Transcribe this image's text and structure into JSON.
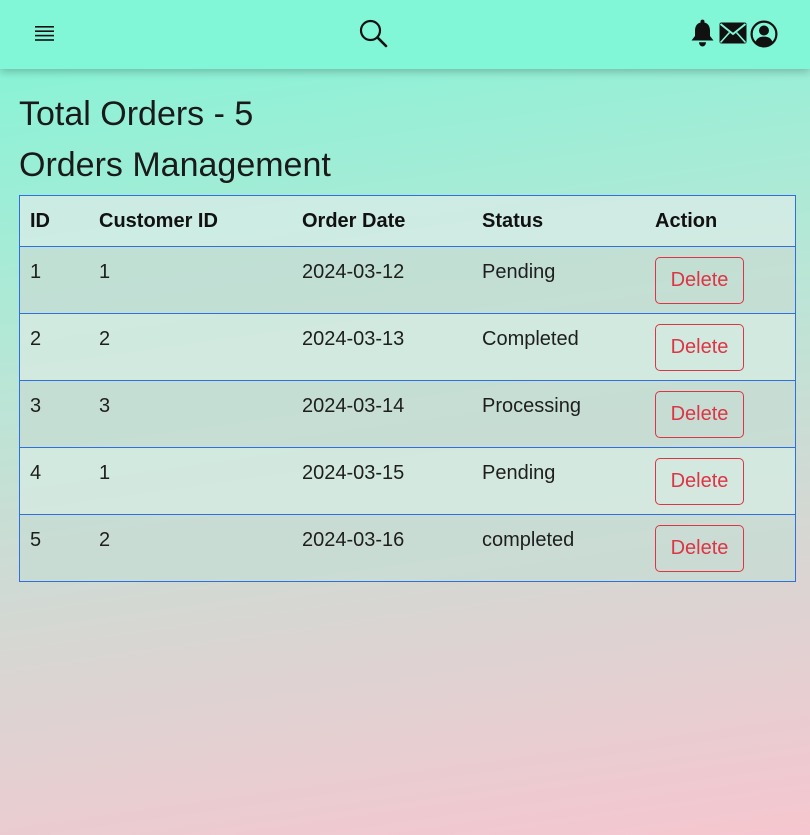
{
  "header": {
    "menu_icon": "hamburger-menu-icon",
    "search_icon": "search-icon",
    "notification_icon": "bell-icon",
    "mail_icon": "mail-icon",
    "account_icon": "user-circle-icon"
  },
  "summary": {
    "total_orders": "Total Orders - 5"
  },
  "page_title": "Orders Management",
  "table": {
    "columns": [
      "ID",
      "Customer ID",
      "Order Date",
      "Status",
      "Action"
    ],
    "rows": [
      {
        "id": "1",
        "customer_id": "1",
        "order_date": "2024-03-12",
        "status": "Pending",
        "action": "Delete"
      },
      {
        "id": "2",
        "customer_id": "2",
        "order_date": "2024-03-13",
        "status": "Completed",
        "action": "Delete"
      },
      {
        "id": "3",
        "customer_id": "3",
        "order_date": "2024-03-14",
        "status": "Processing",
        "action": "Delete"
      },
      {
        "id": "4",
        "customer_id": "1",
        "order_date": "2024-03-15",
        "status": "Pending",
        "action": "Delete"
      },
      {
        "id": "5",
        "customer_id": "2",
        "order_date": "2024-03-16",
        "status": "completed",
        "action": "Delete"
      }
    ]
  },
  "colors": {
    "header_bg": "#82f7d7",
    "table_border": "#2f6fe0",
    "delete_accent": "#dc3545",
    "gradient_top": "#7ef6d6",
    "gradient_bottom": "#f6c6cf"
  }
}
